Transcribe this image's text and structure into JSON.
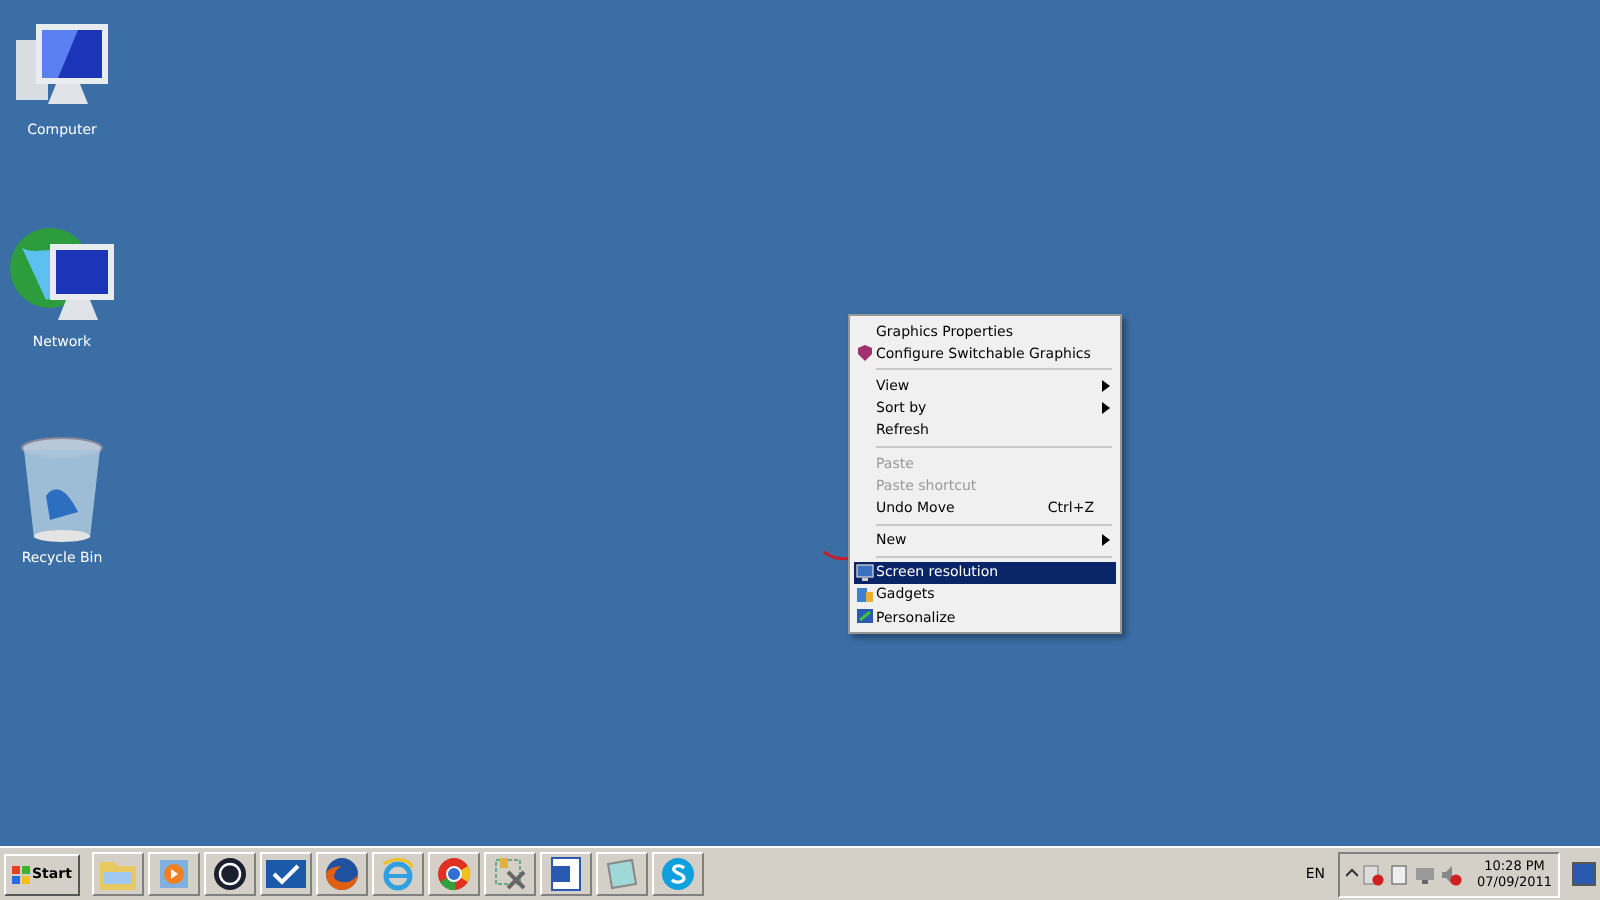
{
  "desktop_icons": [
    {
      "label": "Computer"
    },
    {
      "label": "Network"
    },
    {
      "label": "Recycle Bin"
    }
  ],
  "context_menu": {
    "items": [
      {
        "kind": "item",
        "label": "Graphics Properties",
        "icon": false,
        "submenu": false,
        "disabled": false,
        "selected": false
      },
      {
        "kind": "item",
        "label": "Configure Switchable Graphics",
        "icon": true,
        "submenu": false,
        "disabled": false,
        "selected": false
      },
      {
        "kind": "separator"
      },
      {
        "kind": "item",
        "label": "View",
        "icon": false,
        "submenu": true,
        "disabled": false,
        "selected": false
      },
      {
        "kind": "item",
        "label": "Sort by",
        "icon": false,
        "submenu": true,
        "disabled": false,
        "selected": false
      },
      {
        "kind": "item",
        "label": "Refresh",
        "icon": false,
        "submenu": false,
        "disabled": false,
        "selected": false
      },
      {
        "kind": "separator"
      },
      {
        "kind": "item",
        "label": "Paste",
        "icon": false,
        "submenu": false,
        "disabled": true,
        "selected": false
      },
      {
        "kind": "item",
        "label": "Paste shortcut",
        "icon": false,
        "submenu": false,
        "disabled": true,
        "selected": false
      },
      {
        "kind": "item",
        "label": "Undo Move",
        "shortcut": "Ctrl+Z",
        "icon": false,
        "submenu": false,
        "disabled": false,
        "selected": false
      },
      {
        "kind": "separator"
      },
      {
        "kind": "item",
        "label": "New",
        "icon": false,
        "submenu": true,
        "disabled": false,
        "selected": false
      },
      {
        "kind": "separator"
      },
      {
        "kind": "item",
        "label": "Screen resolution",
        "icon": true,
        "submenu": false,
        "disabled": false,
        "selected": true
      },
      {
        "kind": "item",
        "label": "Gadgets",
        "icon": true,
        "submenu": false,
        "disabled": false,
        "selected": false
      },
      {
        "kind": "item",
        "label": "Personalize",
        "icon": true,
        "submenu": false,
        "disabled": false,
        "selected": false
      }
    ]
  },
  "taskbar": {
    "start_label": "Start",
    "language": "EN",
    "time": "10:28 PM",
    "date": "07/09/2011"
  }
}
